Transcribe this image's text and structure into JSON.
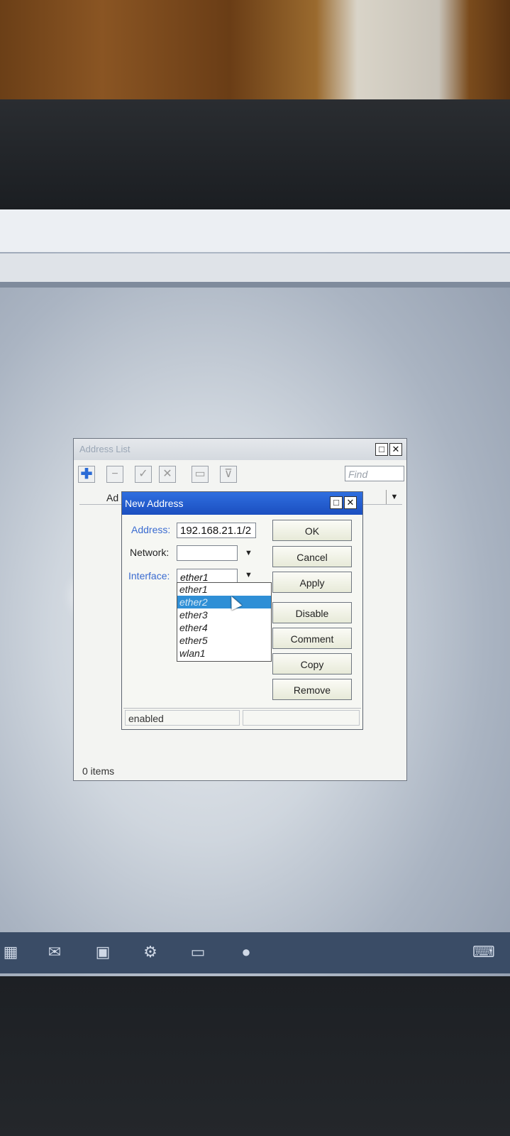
{
  "address_list_window": {
    "title": "Address List",
    "win_buttons": [
      "□",
      "✕"
    ],
    "toolbar": {
      "add_icon": "plus-icon",
      "remove_icon": "minus-icon",
      "enable_icon": "check-icon",
      "disable_icon": "cross-icon",
      "comment_icon": "note-icon",
      "filter_icon": "filter-icon",
      "find_placeholder": "Find"
    },
    "column_header": "Ad",
    "items_count": "0 items"
  },
  "new_address_dialog": {
    "title": "New Address",
    "win_buttons": [
      "□",
      "✕"
    ],
    "address_label": "Address:",
    "address_value": "192.168.21.1/2",
    "network_label": "Network:",
    "network_value": "",
    "interface_label": "Interface:",
    "interface_value": "ether1",
    "interface_options": [
      "ether1",
      "ether2",
      "ether3",
      "ether4",
      "ether5",
      "wlan1"
    ],
    "highlighted_option": "ether2",
    "buttons": {
      "ok": "OK",
      "cancel": "Cancel",
      "apply": "Apply",
      "disable": "Disable",
      "comment": "Comment",
      "copy": "Copy",
      "remove": "Remove"
    },
    "status": "enabled"
  },
  "taskbar": {
    "icons": [
      "mail-icon",
      "app-icon",
      "gear-icon",
      "monitor-icon",
      "globe-icon",
      "keyboard-icon"
    ]
  }
}
